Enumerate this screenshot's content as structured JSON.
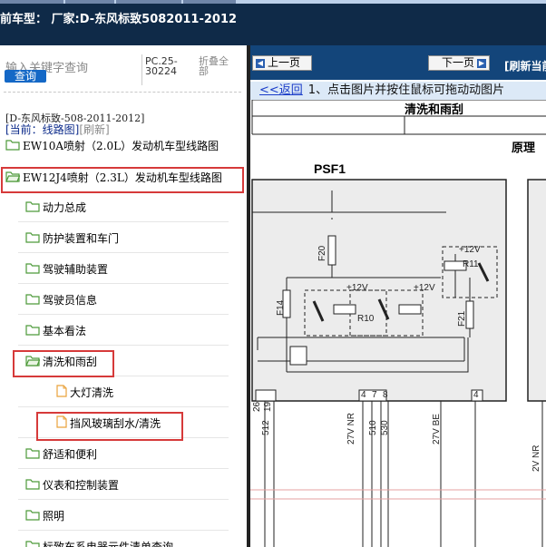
{
  "header": {
    "title": "前车型：  厂家:D-东风标致5082011-2012"
  },
  "sidebar": {
    "search_placeholder": "输入关键字查询",
    "search_button": "查询",
    "pc_code": "PC.25-30224",
    "fold_all": "折叠全部",
    "breadcrumb": "[D-东风标致-508-2011-2012]",
    "current_prefix": "[当前：线路图]",
    "refresh_label": "[刷新]",
    "tree": [
      {
        "label": "EW10A喷射（2.0L）发动机车型线路图",
        "kind": "folder",
        "level": 0
      },
      {
        "label": "EW12J4喷射（2.3L）发动机车型线路图",
        "kind": "folder-open",
        "level": 0,
        "highlighted": true
      },
      {
        "label": "动力总成",
        "kind": "folder",
        "level": 1
      },
      {
        "label": "防护装置和车门",
        "kind": "folder",
        "level": 1
      },
      {
        "label": "驾驶辅助装置",
        "kind": "folder",
        "level": 1
      },
      {
        "label": "驾驶员信息",
        "kind": "folder",
        "level": 1
      },
      {
        "label": "基本看法",
        "kind": "folder",
        "level": 1
      },
      {
        "label": "清洗和雨刮",
        "kind": "folder-open",
        "level": 1,
        "highlighted": true
      },
      {
        "label": "大灯清洗",
        "kind": "file",
        "level": 2
      },
      {
        "label": "挡风玻璃刮水/清洗",
        "kind": "file",
        "level": 2,
        "highlighted": true
      },
      {
        "label": "舒适和便利",
        "kind": "folder",
        "level": 1
      },
      {
        "label": "仪表和控制装置",
        "kind": "folder",
        "level": 1
      },
      {
        "label": "照明",
        "kind": "folder",
        "level": 1
      },
      {
        "label": "标致车系电器元件清单查询",
        "kind": "folder",
        "level": 1
      }
    ]
  },
  "viewer": {
    "prev_button": "上一页",
    "next_button": "下一页",
    "refresh_current": "[刷新当前",
    "back_link": "<<返回",
    "instruction": "1、点击图片并按住鼠标可拖动动图片",
    "diagram": {
      "title": "清洗和雨刮",
      "principle": "原理",
      "box_label": "PSF1",
      "fuses": [
        "F20",
        "F14",
        "F21"
      ],
      "relays": [
        "R10",
        "R11"
      ],
      "supply_labels": [
        "+12V",
        "+12V",
        "+12V"
      ],
      "pin_numbers": [
        "26",
        "19",
        "4",
        "7",
        "8",
        "4"
      ],
      "wire_labels": [
        "512",
        "27V NR",
        "510",
        "530",
        "27V BE",
        "2V NR"
      ]
    }
  },
  "colors": {
    "header_bg": "#0f2a48",
    "viewer_bar_bg": "#13457a",
    "highlight": "#d63a3a",
    "folder_icon": "#4e9a3a",
    "file_icon": "#e9a23b",
    "link": "#1a3cc8"
  }
}
